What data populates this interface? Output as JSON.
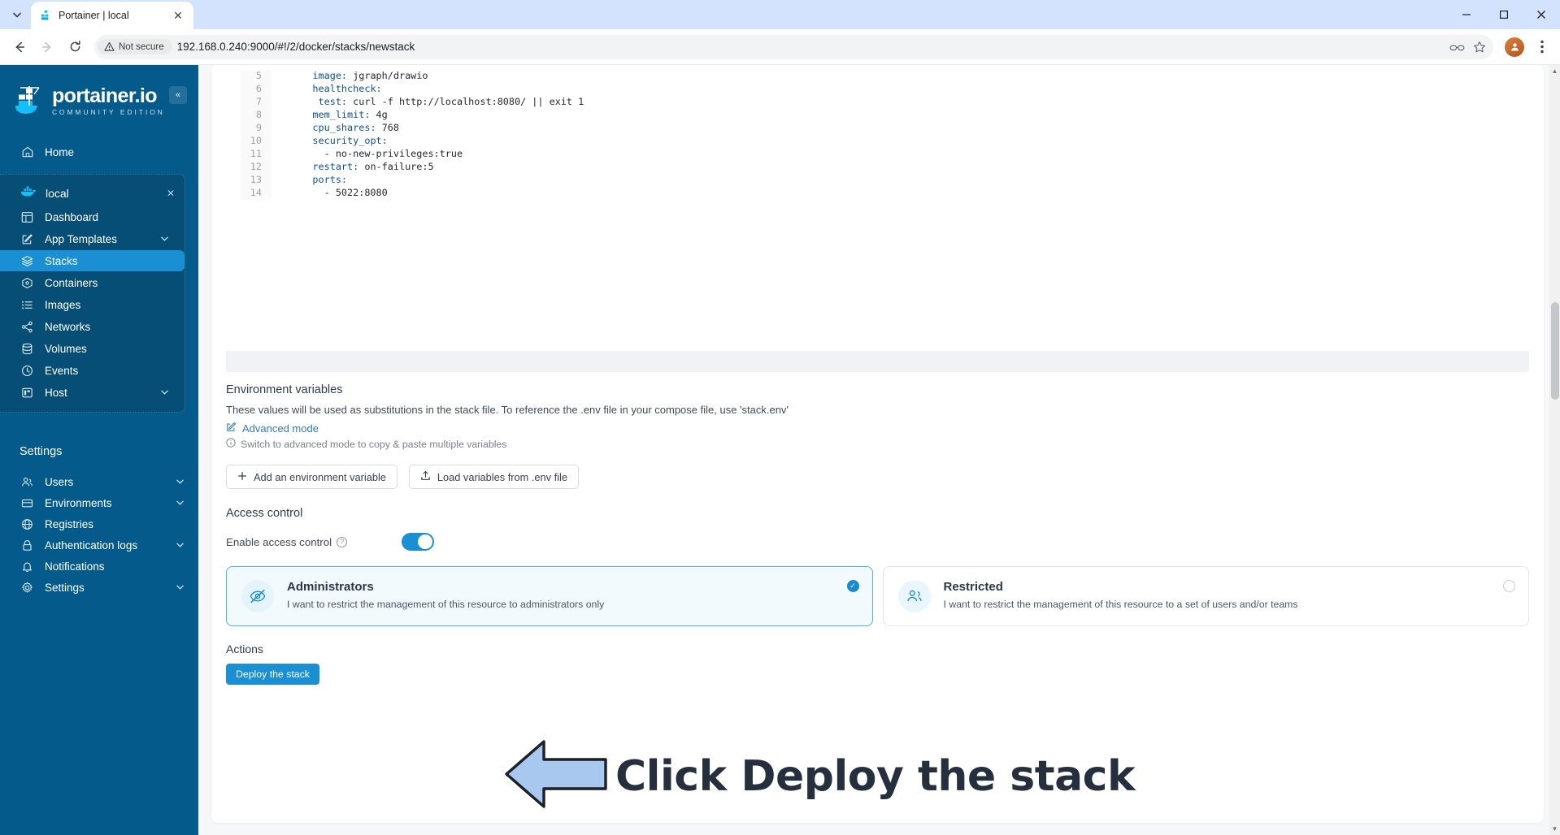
{
  "browser": {
    "tab": {
      "title": "Portainer | local",
      "favicon": "portainer-icon",
      "close": "✕"
    },
    "tab_list_icon": "chevron-down-icon",
    "window": {
      "minimize": "─",
      "maximize": "□",
      "close": "✕"
    },
    "nav": {
      "back": "←",
      "forward": "→",
      "reload": "↻"
    },
    "security_label": "Not secure",
    "url": "192.168.0.240:9000/#!/2/docker/stacks/newstack",
    "omni_icons": [
      "glasses-icon",
      "star-icon"
    ],
    "menu_icon": "kebab-menu-icon"
  },
  "sidebar": {
    "logo_name": "portainer.io",
    "logo_sub": "COMMUNITY EDITION",
    "collapse_icon": "«",
    "top_items": [
      {
        "label": "Home",
        "icon": "home-icon"
      }
    ],
    "environment": {
      "name": "local",
      "icon": "docker-icon",
      "close_icon": "✕",
      "items": [
        {
          "label": "Dashboard",
          "icon": "dashboard-icon",
          "chevron": false,
          "active": false
        },
        {
          "label": "App Templates",
          "icon": "templates-icon",
          "chevron": true,
          "active": false
        },
        {
          "label": "Stacks",
          "icon": "stacks-icon",
          "chevron": false,
          "active": true
        },
        {
          "label": "Containers",
          "icon": "containers-icon",
          "chevron": false,
          "active": false
        },
        {
          "label": "Images",
          "icon": "images-icon",
          "chevron": false,
          "active": false
        },
        {
          "label": "Networks",
          "icon": "networks-icon",
          "chevron": false,
          "active": false
        },
        {
          "label": "Volumes",
          "icon": "volumes-icon",
          "chevron": false,
          "active": false
        },
        {
          "label": "Events",
          "icon": "events-icon",
          "chevron": false,
          "active": false
        },
        {
          "label": "Host",
          "icon": "host-icon",
          "chevron": true,
          "active": false
        }
      ]
    },
    "settings_label": "Settings",
    "settings_items": [
      {
        "label": "Users",
        "icon": "users-icon",
        "chevron": true
      },
      {
        "label": "Environments",
        "icon": "environments-icon",
        "chevron": true
      },
      {
        "label": "Registries",
        "icon": "registries-icon",
        "chevron": false
      },
      {
        "label": "Authentication logs",
        "icon": "auth-logs-icon",
        "chevron": true
      },
      {
        "label": "Notifications",
        "icon": "bell-icon",
        "chevron": false
      },
      {
        "label": "Settings",
        "icon": "gear-icon",
        "chevron": true
      }
    ]
  },
  "editor": {
    "lines": [
      {
        "no": "5",
        "text": "    image: jgraph/drawio"
      },
      {
        "no": "6",
        "text": "    healthcheck:"
      },
      {
        "no": "7",
        "text": "     test: curl -f http://localhost:8080/ || exit 1"
      },
      {
        "no": "8",
        "text": "    mem_limit: 4g"
      },
      {
        "no": "9",
        "text": "    cpu_shares: 768"
      },
      {
        "no": "10",
        "text": "    security_opt:"
      },
      {
        "no": "11",
        "text": "      - no-new-privileges:true"
      },
      {
        "no": "12",
        "text": "    restart: on-failure:5"
      },
      {
        "no": "13",
        "text": "    ports:"
      },
      {
        "no": "14",
        "text": "      - 5022:8080"
      }
    ]
  },
  "env_vars": {
    "title": "Environment variables",
    "description": "These values will be used as substitutions in the stack file. To reference the .env file in your compose file, use 'stack.env'",
    "advanced_mode": "Advanced mode",
    "advanced_icon": "edit-icon",
    "hint": "Switch to advanced mode to copy & paste multiple variables",
    "hint_icon": "info-icon",
    "add_button": "Add an environment variable",
    "add_icon": "plus-icon",
    "load_button": "Load variables from .env file",
    "load_icon": "upload-icon"
  },
  "access_control": {
    "title": "Access control",
    "toggle_label": "Enable access control",
    "toggle_help_icon": "question-icon",
    "toggle_on": true,
    "options": [
      {
        "title": "Administrators",
        "subtitle": "I want to restrict the management of this resource to administrators only",
        "icon": "eye-off-icon",
        "selected": true,
        "check": "✓"
      },
      {
        "title": "Restricted",
        "subtitle": "I want to restrict the management of this resource to a set of users and/or teams",
        "icon": "users-group-icon",
        "selected": false,
        "check": ""
      }
    ]
  },
  "actions": {
    "title": "Actions",
    "deploy_button": "Deploy the stack"
  },
  "annotation": {
    "text": "Click Deploy the stack",
    "arrow": "left-arrow-annotation",
    "arrow_fill": "#a8c8f0",
    "text_color": "#262f3d"
  },
  "colors": {
    "sidebar": "#055a8c",
    "sidebar_group": "#074e77",
    "accent": "#1a8fd4",
    "card_selected_bg": "#f2fafe",
    "card_selected_border": "#4eb3e8",
    "tabstrip": "#d3e3fd"
  }
}
